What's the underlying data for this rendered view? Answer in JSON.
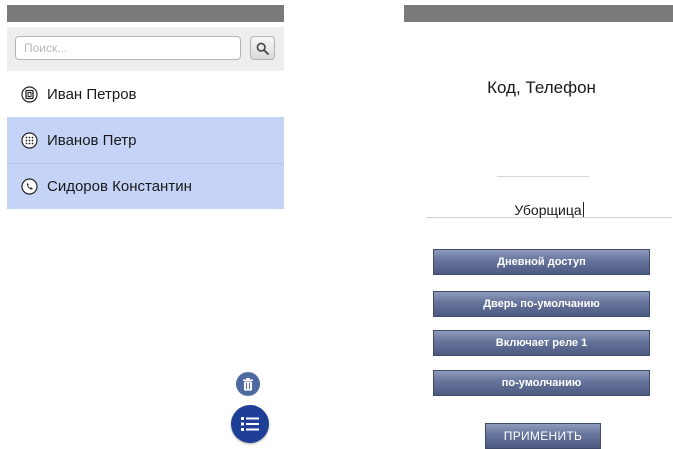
{
  "left_pane": {
    "search": {
      "placeholder": "Поиск...",
      "value": ""
    },
    "contacts": [
      {
        "name": "Иван Петров",
        "icon": "card-reader-icon",
        "selected": false
      },
      {
        "name": "Иванов Петр",
        "icon": "keypad-icon",
        "selected": true
      },
      {
        "name": "Сидоров Константин",
        "icon": "phone-icon",
        "selected": true
      }
    ]
  },
  "right_pane": {
    "title": "Код, Телефон",
    "role": "Уборщица",
    "buttons": {
      "day_access": "Дневной доступ",
      "default_door": "Дверь по-умолчанию",
      "relay": "Включает реле 1",
      "default": "по-умолчанию"
    },
    "apply_label": "ПРИМЕНИТЬ"
  },
  "colors": {
    "selected_row": "#c5d3f7",
    "fab_primary": "#1f3f97",
    "fab_secondary": "#4f6aa3",
    "button_gradient_mid": "#66739a",
    "status_bar": "#7a7a7a"
  }
}
